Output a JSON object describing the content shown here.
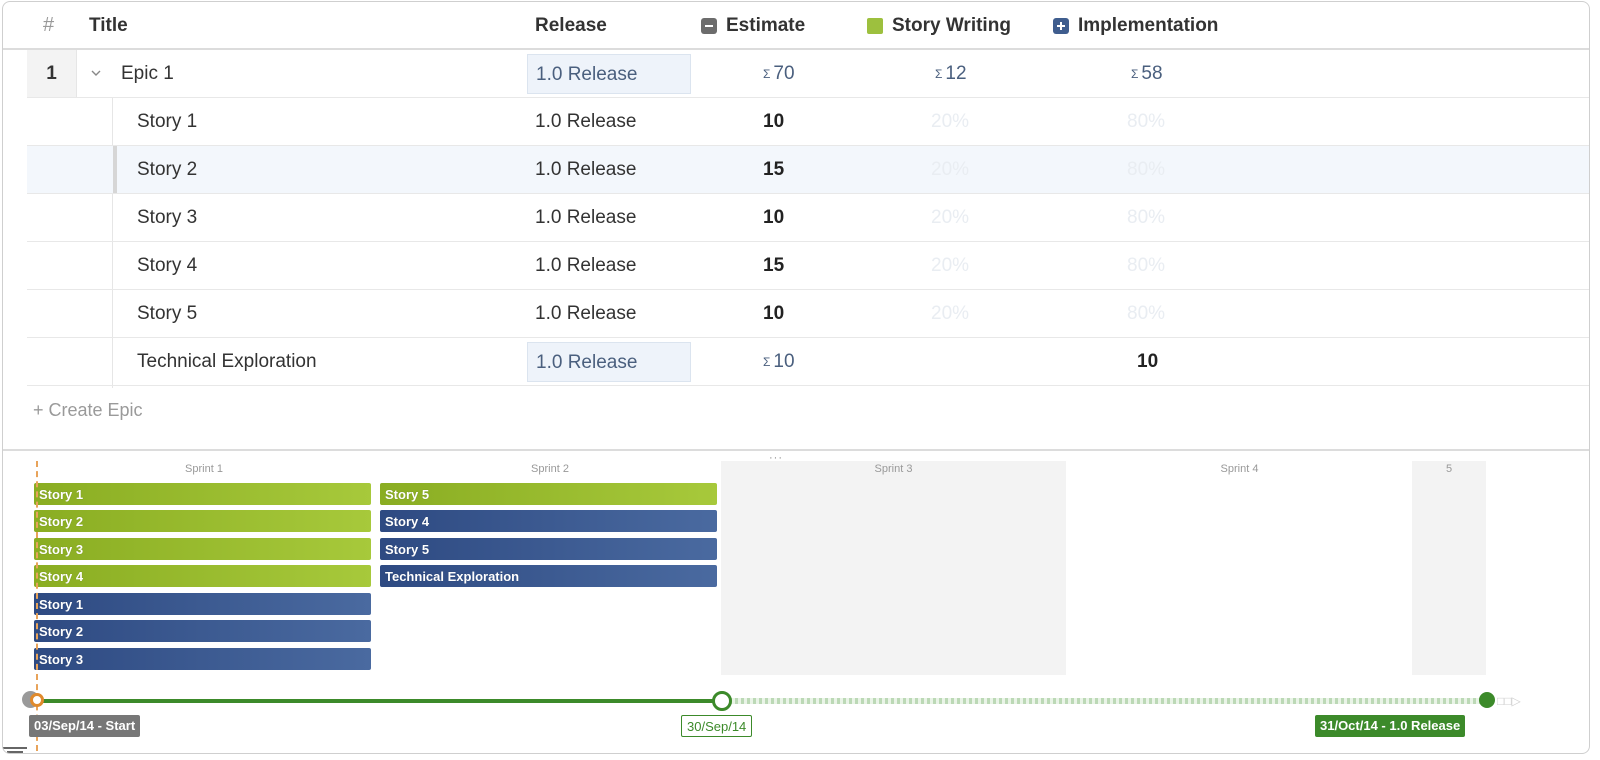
{
  "header": {
    "num": "#",
    "title": "Title",
    "release": "Release",
    "estimate": "Estimate",
    "story_writing": "Story Writing",
    "implementation": "Implementation"
  },
  "epic": {
    "num": "1",
    "title": "Epic 1",
    "release": "1.0 Release",
    "estimate_sigma": "Σ",
    "estimate": "70",
    "story_writing": "12",
    "implementation": "58"
  },
  "rows": [
    {
      "title": "Story 1",
      "release": "1.0 Release",
      "estimate": "10",
      "story_writing": "20%",
      "implementation": "80%"
    },
    {
      "title": "Story 2",
      "release": "1.0 Release",
      "estimate": "15",
      "story_writing": "20%",
      "implementation": "80%"
    },
    {
      "title": "Story 3",
      "release": "1.0 Release",
      "estimate": "10",
      "story_writing": "20%",
      "implementation": "80%"
    },
    {
      "title": "Story 4",
      "release": "1.0 Release",
      "estimate": "15",
      "story_writing": "20%",
      "implementation": "80%"
    },
    {
      "title": "Story 5",
      "release": "1.0 Release",
      "estimate": "10",
      "story_writing": "20%",
      "implementation": "80%"
    }
  ],
  "tech_row": {
    "title": "Technical Exploration",
    "release": "1.0 Release",
    "estimate": "10",
    "implementation": "10"
  },
  "create_epic": "+ Create Epic",
  "grip": "···",
  "sprints": [
    "Sprint 1",
    "Sprint 2",
    "Sprint 3",
    "Sprint 4",
    "5"
  ],
  "sprint1_bars": [
    "Story 1",
    "Story 2",
    "Story 3",
    "Story 4",
    "Story 1",
    "Story 2",
    "Story 3"
  ],
  "sprint2_bars": [
    "Story 5",
    "Story 4",
    "Story 5",
    "Technical Exploration"
  ],
  "timeline": {
    "start": "03/Sep/14 - Start",
    "mid": "30/Sep/14",
    "end": "31/Oct/14 - 1.0 Release"
  },
  "colors": {
    "story_writing": "#9dc03e",
    "implementation": "#3f5d8e",
    "timeline": "#3c8a2a",
    "start_marker": "#e08a2c"
  }
}
